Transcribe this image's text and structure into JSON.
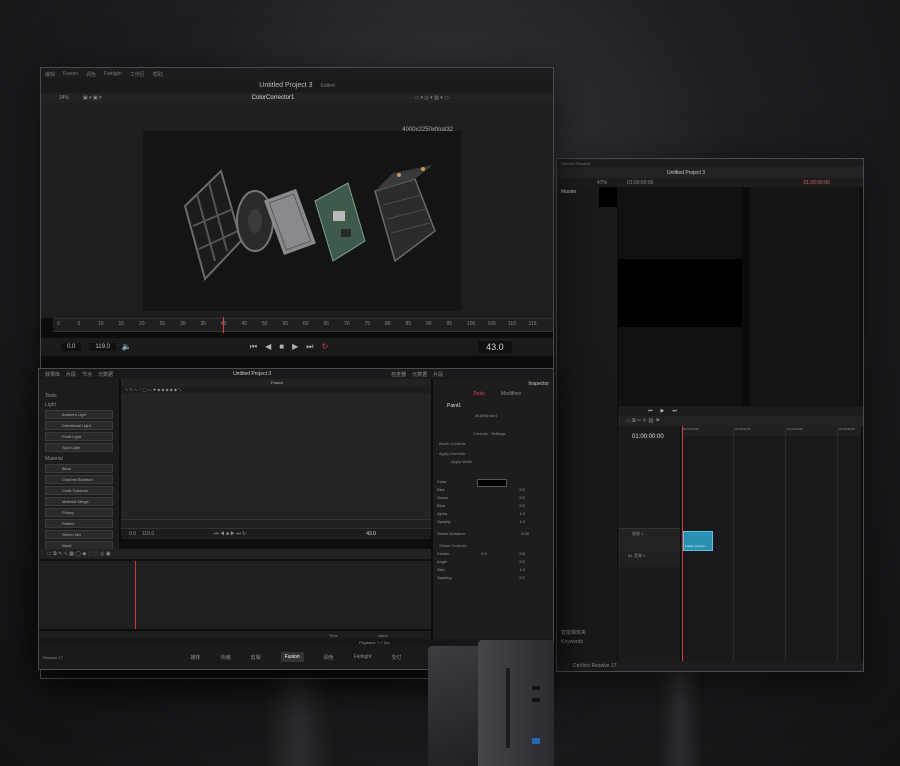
{
  "left_monitor": {
    "menu": [
      "编辑",
      "Fusion",
      "调色",
      "Fairlight",
      "工作区",
      "帮助"
    ],
    "project_title": "Untitled Project 3",
    "project_status": "Edited",
    "zoom": "34%",
    "viewer_node": "ColorCorrector1",
    "resolution_label": "4000x2250xfloat32",
    "ruler_ticks": [
      "0",
      "5",
      "10",
      "15",
      "20",
      "25",
      "30",
      "35",
      "40",
      "45",
      "50",
      "55",
      "60",
      "65",
      "70",
      "75",
      "80",
      "85",
      "90",
      "95",
      "100",
      "105",
      "110",
      "115"
    ],
    "transport": {
      "start": "0.0",
      "end": "119.0",
      "current": "43.0"
    }
  },
  "bottom_monitor": {
    "project_title": "Untitled Project 3",
    "panel_name": "Fusion",
    "header_tabs": [
      "效果库",
      "片段",
      "节点",
      "元数据"
    ],
    "header_right": [
      "检查器",
      "元数据",
      "片段"
    ],
    "left_section": "Tools",
    "lights_header": "Light",
    "lights": [
      "Ambient Light",
      "Directional Light",
      "Point Light",
      "Spot Light"
    ],
    "material_header": "Material",
    "materials": [
      "Blinn",
      "Channel Boolean",
      "Cook Torrance",
      "Material Merge",
      "Phong",
      "Reflect",
      "Stereo Mix",
      "Ward"
    ],
    "inspector": {
      "title": "Inspector",
      "tabs": [
        "Tools",
        "Modifiers"
      ],
      "node": "Paint1",
      "subtitle": "MultiStroke1",
      "subtabs": [
        "Controls",
        "Settings"
      ],
      "sections": [
        "Brush Controls",
        "Apply Controls",
        "Stroke Controls"
      ],
      "apply_mode_label": "Apply Mode",
      "color_rows": [
        {
          "label": "Color",
          "value": ""
        },
        {
          "label": "Red",
          "value": "0.0"
        },
        {
          "label": "Green",
          "value": "0.0"
        },
        {
          "label": "Blue",
          "value": "0.0"
        },
        {
          "label": "Alpha",
          "value": "1.0"
        },
        {
          "label": "Opacity",
          "value": "1.0"
        }
      ],
      "stroke_duration_label": "Stroke Duration",
      "stroke_duration_value": "5.00",
      "stroke_rows": [
        {
          "label": "Center",
          "x": "0.5",
          "y": "0.5"
        },
        {
          "label": "Angle",
          "value": "0.0"
        },
        {
          "label": "Size",
          "value": "1.0"
        },
        {
          "label": "Spacing",
          "value": "0.1"
        }
      ]
    },
    "transport": {
      "start": "0.0",
      "end": "119.0",
      "current": "43.0"
    },
    "spline_footer": {
      "time_label": "Time",
      "value_label": "Value"
    },
    "status_left": "Resolve 17",
    "playback_info": "Playback: 1.7 fps",
    "pages": [
      "媒体",
      "快编",
      "剪辑",
      "Fusion",
      "调色",
      "Fairlight",
      "交付"
    ],
    "active_page": "Fusion"
  },
  "right_monitor": {
    "app_title": "DaVinci Resolve",
    "project_title": "Untitled Project 3",
    "media_tab": "Master",
    "zoom": "47%",
    "timecode_left": "01:00:00:00",
    "timecode_right": "01:00:00:00",
    "timeline_start": "01:00:00:00",
    "ruler_labels": [
      "01:00:00:00",
      "01:00:02:00",
      "01:00:04:00",
      "01:00:06:00"
    ],
    "video_track": "视频 1",
    "audio_track": "A1 音频 1",
    "clip_name": "Fusion Compo...",
    "smart_bins": "智能媒体夹",
    "keywords": "Keywords",
    "footer": "DaVinci Resolve 17"
  },
  "colors": {
    "accent_red": "#e0413a",
    "clip_blue": "#2b8fb2",
    "playhead": "#d63a33",
    "panel": "#1f1f21"
  }
}
